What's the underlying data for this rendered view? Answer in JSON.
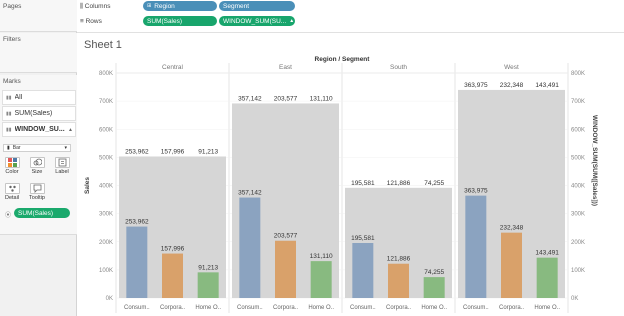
{
  "shelves": {
    "columns_label": "Columns",
    "rows_label": "Rows",
    "columns": [
      "Region",
      "Segment"
    ],
    "rows": [
      "SUM(Sales)",
      "WINDOW_SUM(SU..."
    ]
  },
  "sidebar": {
    "pages": "Pages",
    "filters": "Filters",
    "marks": "Marks",
    "mark_cards": [
      {
        "label": "All"
      },
      {
        "label": "SUM(Sales)"
      },
      {
        "label": "WINDOW_SU..."
      }
    ],
    "mark_type": "Bar",
    "tiles": [
      "Color",
      "Size",
      "Label",
      "Detail",
      "Tooltip"
    ],
    "color_pill": "SUM(Sales)"
  },
  "sheet": {
    "title": "Sheet 1",
    "header_title": "Region / Segment"
  },
  "chart_data": {
    "type": "bar",
    "title": "",
    "column_header": "Region / Segment",
    "regions": [
      "Central",
      "East",
      "South",
      "West"
    ],
    "categories": [
      "Consum..",
      "Corpora..",
      "Home O.."
    ],
    "ylabel_left": "Sales",
    "ylabel_right": "WINDOW_SUM(SUM([Sales]))",
    "ylim": [
      0,
      800000
    ],
    "yticks": [
      "0K",
      "100K",
      "200K",
      "300K",
      "400K",
      "500K",
      "600K",
      "700K",
      "800K"
    ],
    "series_sales": [
      [
        253962,
        157996,
        91213
      ],
      [
        357142,
        203577,
        131110
      ],
      [
        195581,
        121886,
        74255
      ],
      [
        363975,
        232348,
        143491
      ]
    ],
    "series_window_sum": [
      503171,
      691829,
      391722,
      739814
    ],
    "labels_sales": [
      [
        "253,962",
        "157,996",
        "91,213"
      ],
      [
        "357,142",
        "203,577",
        "131,110"
      ],
      [
        "195,581",
        "121,886",
        "74,255"
      ],
      [
        "363,975",
        "232,348",
        "143,491"
      ]
    ],
    "colors": {
      "Consumer": "#8ba3c0",
      "Corporate": "#d9a16a",
      "Home Office": "#88ba80",
      "window": "#d6d6d6"
    }
  }
}
